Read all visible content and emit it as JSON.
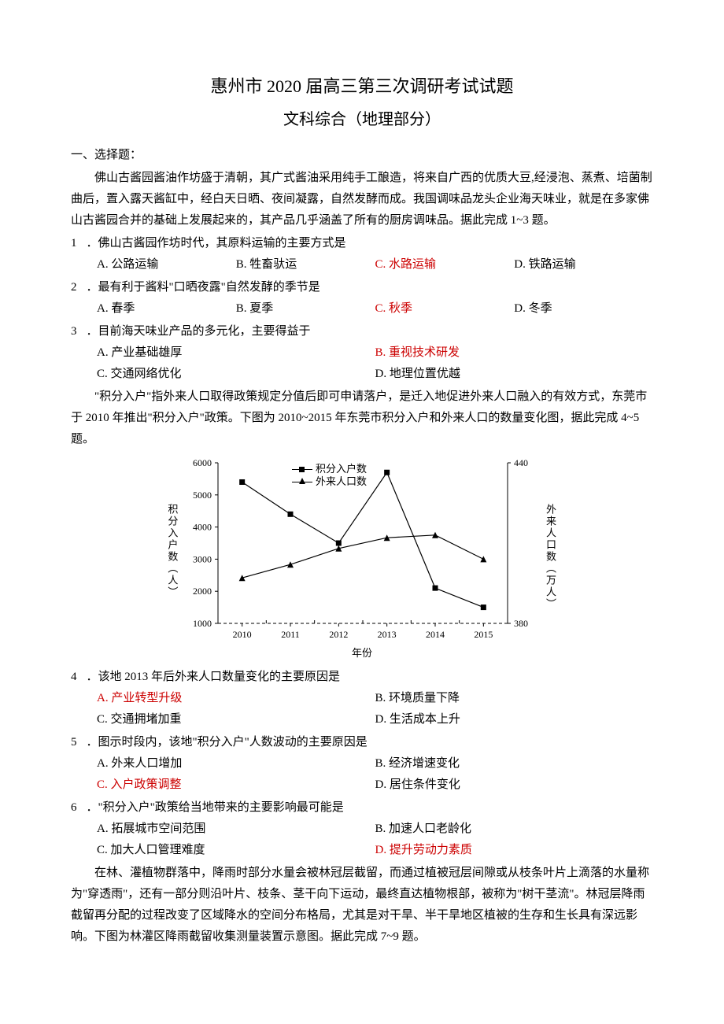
{
  "header": {
    "title": "惠州市 2020 届高三第三次调研考试试题",
    "subtitle": "文科综合（地理部分）"
  },
  "section1": "一、选择题：",
  "passage1": "佛山古酱园酱油作坊盛于清朝，其广式酱油采用纯手工酿造，将来自广西的优质大豆,经浸泡、蒸煮、培菌制曲后，置入露天酱缸中，经白天日晒、夜间凝露，自然发酵而成。我国调味品龙头企业海天味业，就是在多家佛山古酱园合并的基础上发展起来的，其产品几乎涵盖了所有的厨房调味品。据此完成 1~3 题。",
  "q1": {
    "num": "1",
    "text": "．佛山古酱园作坊时代，其原料运输的主要方式是",
    "opts": {
      "a": "A. 公路运输",
      "b": "B. 牲畜驮运",
      "c": "C. 水路运输",
      "d": "D. 铁路运输"
    },
    "ans": "c"
  },
  "q2": {
    "num": "2",
    "text": "．最有利于酱料\"口晒夜露\"自然发酵的季节是",
    "opts": {
      "a": "A. 春季",
      "b": "B. 夏季",
      "c": "C. 秋季",
      "d": "D. 冬季"
    },
    "ans": "c"
  },
  "q3": {
    "num": "3",
    "text": "．目前海天味业产品的多元化，主要得益于",
    "opts": {
      "a": "A. 产业基础雄厚",
      "b": "B. 重视技术研发",
      "c": "C. 交通网络优化",
      "d": "D. 地理位置优越"
    },
    "ans": "b"
  },
  "passage2": "\"积分入户\"指外来人口取得政策规定分值后即可申请落户，是迁入地促进外来人口融入的有效方式，东莞市于 2010 年推出\"积分入户\"政策。下图为 2010~2015 年东莞市积分入户和外来人口的数量变化图，据此完成 4~5 题。",
  "chart_data": {
    "type": "line",
    "x": [
      2010,
      2011,
      2012,
      2013,
      2014,
      2015
    ],
    "series": [
      {
        "name": "积分入户数",
        "axis": "left",
        "marker": "square",
        "values": [
          5400,
          4400,
          3500,
          5700,
          2100,
          1500
        ]
      },
      {
        "name": "外来人口数",
        "axis": "right",
        "marker": "triangle",
        "values": [
          397,
          402,
          408,
          412,
          413,
          404
        ]
      }
    ],
    "y_left": {
      "label": "积分入户数（人）",
      "min": 1000,
      "max": 6000,
      "ticks": [
        1000,
        2000,
        3000,
        4000,
        5000,
        6000
      ]
    },
    "y_right": {
      "label": "外来人口数（万人）",
      "min": 380,
      "max": 440,
      "ticks": [
        380,
        440
      ]
    },
    "xlabel": "年份"
  },
  "q4": {
    "num": "4",
    "text": "．该地 2013 年后外来人口数量变化的主要原因是",
    "opts": {
      "a": "A. 产业转型升级",
      "b": "B. 环境质量下降",
      "c": "C. 交通拥堵加重",
      "d": "D. 生活成本上升"
    },
    "ans": "a"
  },
  "q5": {
    "num": "5",
    "text": "．图示时段内，该地\"积分入户\"人数波动的主要原因是",
    "opts": {
      "a": "A. 外来人口增加",
      "b": "B. 经济增速变化",
      "c": "C. 入户政策调整",
      "d": "D. 居住条件变化"
    },
    "ans": "c"
  },
  "q6": {
    "num": "6",
    "text": "．\"积分入户\"政策给当地带来的主要影响最可能是",
    "opts": {
      "a": "A. 拓展城市空间范围",
      "b": "B. 加速人口老龄化",
      "c": "C. 加大人口管理难度",
      "d": "D. 提升劳动力素质"
    },
    "ans": "d"
  },
  "passage3": "在林、灌植物群落中，降雨时部分水量会被林冠层截留，而通过植被冠层间隙或从枝条叶片上滴落的水量称为\"穿透雨\"，还有一部分则沿叶片、枝条、茎干向下运动，最终直达植物根部，被称为\"树干茎流\"。林冠层降雨截留再分配的过程改变了区域降水的空间分布格局，尤其是对干旱、半干旱地区植被的生存和生长具有深远影响。下图为林灌区降雨截留收集测量装置示意图。据此完成 7~9 题。",
  "legend": {
    "s1": "积分入户数",
    "s2": "外来人口数"
  }
}
